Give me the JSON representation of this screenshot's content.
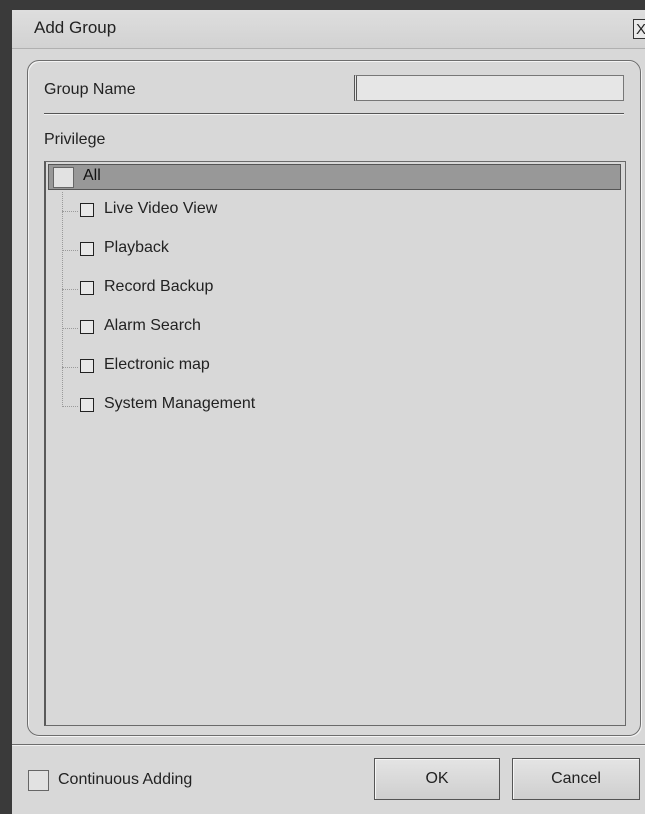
{
  "dialog": {
    "title": "Add Group",
    "close_glyph": "X"
  },
  "form": {
    "group_name_label": "Group Name",
    "group_name_value": "",
    "privilege_label": "Privilege"
  },
  "tree": {
    "root": {
      "label": "All",
      "checked": false
    },
    "items": [
      {
        "label": "Live Video View",
        "checked": false
      },
      {
        "label": "Playback",
        "checked": false
      },
      {
        "label": "Record Backup",
        "checked": false
      },
      {
        "label": "Alarm Search",
        "checked": false
      },
      {
        "label": "Electronic map",
        "checked": false
      },
      {
        "label": "System Management",
        "checked": false
      }
    ]
  },
  "footer": {
    "continuous_adding_label": "Continuous Adding",
    "continuous_adding_checked": false,
    "ok_label": "OK",
    "cancel_label": "Cancel"
  },
  "colors": {
    "dialog_bg": "#d8d8d8",
    "selected_row": "#989898",
    "frame": "#3a3a3a"
  }
}
